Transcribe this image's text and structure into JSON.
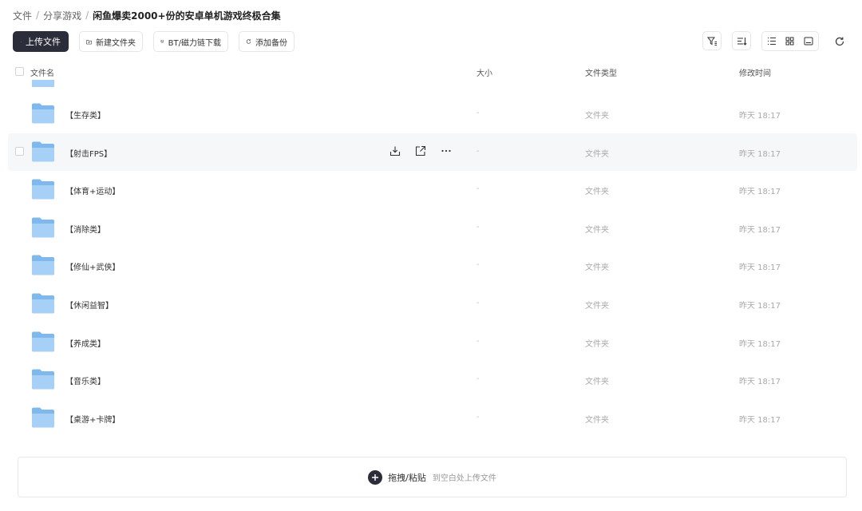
{
  "breadcrumb": [
    "文件",
    "分享游戏",
    "闲鱼爆卖2000+份的安卓单机游戏终极合集"
  ],
  "toolbar": {
    "upload": "上传文件",
    "new_folder": "新建文件夹",
    "bt": "BT/磁力链下载",
    "backup": "添加备份"
  },
  "columns": {
    "name": "文件名",
    "size": "大小",
    "type": "文件类型",
    "mtime": "修改时间"
  },
  "rows": [
    {
      "name": "【生存类】",
      "size": "-",
      "type": "文件夹",
      "mtime": "昨天 18:17"
    },
    {
      "name": "【射击FPS】",
      "size": "-",
      "type": "文件夹",
      "mtime": "昨天 18:17"
    },
    {
      "name": "【体育+运动】",
      "size": "-",
      "type": "文件夹",
      "mtime": "昨天 18:17"
    },
    {
      "name": "【消除类】",
      "size": "-",
      "type": "文件夹",
      "mtime": "昨天 18:17"
    },
    {
      "name": "【修仙+武侠】",
      "size": "-",
      "type": "文件夹",
      "mtime": "昨天 18:17"
    },
    {
      "name": "【休闲益智】",
      "size": "-",
      "type": "文件夹",
      "mtime": "昨天 18:17"
    },
    {
      "name": "【养成类】",
      "size": "-",
      "type": "文件夹",
      "mtime": "昨天 18:17"
    },
    {
      "name": "【音乐类】",
      "size": "-",
      "type": "文件夹",
      "mtime": "昨天 18:17"
    },
    {
      "name": "【桌游+卡牌】",
      "size": "-",
      "type": "文件夹",
      "mtime": "昨天 18:17"
    }
  ],
  "dropzone": {
    "primary": "拖拽/粘贴",
    "secondary": "到空白处上传文件"
  },
  "icons": {
    "upload": "plus-icon",
    "new_folder": "folder-plus-icon",
    "bt": "magnet-icon",
    "backup": "sync-icon",
    "filter": "filter-icon",
    "sort": "sort-icon",
    "list": "list-view-icon",
    "grid": "grid-view-icon",
    "thumb": "thumbnail-view-icon",
    "refresh": "refresh-icon",
    "folder": "folder-icon",
    "download": "download-icon",
    "share": "share-icon",
    "more": "more-icon"
  },
  "colors": {
    "primary": "#2b2d3a",
    "folder": "#7fb8ec",
    "hover_row": "#f6f7f9"
  }
}
